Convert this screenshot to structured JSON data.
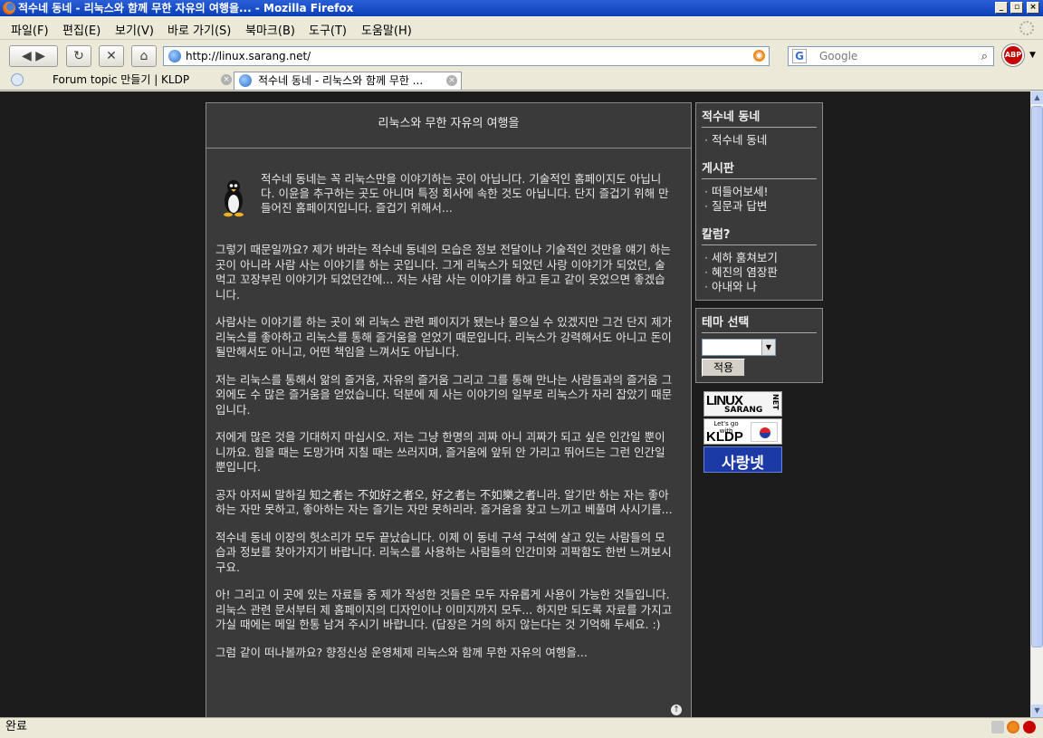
{
  "window": {
    "title": "적수네 동네 - 리눅스와 함께 무한 자유의 여행을... - Mozilla Firefox",
    "min": "_",
    "max": "▫",
    "close": "×"
  },
  "menu": [
    "파일(F)",
    "편집(E)",
    "보기(V)",
    "바로 가기(S)",
    "북마크(B)",
    "도구(T)",
    "도움말(H)"
  ],
  "nav": {
    "back": "◀ ▶",
    "reload": "↻",
    "stop": "✕",
    "home": "⌂",
    "url": "http://linux.sarang.net/",
    "search_placeholder": "Google",
    "search_engine": "G",
    "abp": "ABP"
  },
  "tabs": [
    {
      "label": "Forum topic 만들기 | KLDP",
      "active": false
    },
    {
      "label": "적수네 동네 - 리눅스와 함께 무한 ...",
      "active": true
    }
  ],
  "page": {
    "header": "리눅스와 무한 자유의 여행을",
    "intro": "적수네 동네는 꼭 리눅스만을 이야기하는 곳이 아닙니다. 기술적인 홈페이지도 아닙니다. 이윤을 추구하는 곳도 아니며 특정 회사에 속한 것도 아닙니다. 단지 즐겁기 위해 만들어진 홈페이지입니다. 즐겁기 위해서...",
    "paragraphs": [
      "그렇기 때문일까요? 제가 바라는 적수네 동네의 모습은 정보 전달이나 기술적인 것만을 얘기 하는 곳이 아니라 사람 사는 이야기를 하는 곳입니다. 그게 리눅스가 되었던 사랑 이야기가 되었던, 술 먹고 꼬장부린 이야기가 되었던간에... 저는 사람 사는 이야기를 하고 듣고 같이 웃었으면 좋겠습니다.",
      "사람사는 이야기를 하는 곳이 왜 리눅스 관련 페이지가 됐는냐 물으실 수 있겠지만 그건 단지 제가 리눅스를 좋아하고 리눅스를 통해 즐거움을 얻었기 때문입니다. 리눅스가 강력해서도 아니고 돈이 될만해서도 아니고, 어떤 책임을 느껴서도 아닙니다.",
      "저는 리눅스를 통해서 앎의 즐거움, 자유의 즐거움 그리고 그를 통해 만나는 사람들과의 즐거움 그 외에도 수 많은 즐거움을 얻었습니다. 덕분에 제 사는 이야기의 일부로 리눅스가 자리 잡았기 때문입니다.",
      "저에게 많은 것을 기대하지 마십시오. 저는 그냥 한명의 괴짜 아니 괴짜가 되고 싶은 인간일 뿐이니까요. 힘을 때는 도망가며 지칠 때는 쓰러지며, 즐거움에 앞뒤 안 가리고 뛰어드는 그런 인간일 뿐입니다.",
      "공자 아저씨 말하길 知之者는 不如好之者오, 好之者는 不如樂之者니라. 알기만 하는 자는 좋아하는 자만 못하고, 좋아하는 자는 즐기는 자만 못하리라. 즐거움을 찾고 느끼고 베풀며 사시기를...",
      "적수네 동네 이장의 헛소리가 모두 끝났습니다. 이제 이 동네 구석 구석에 살고 있는 사람들의 모습과 정보를 찾아가지기 바랍니다. 리눅스를 사용하는 사람들의 인간미와 괴팍함도 한번 느껴보시구요.",
      "아! 그리고 이 곳에 있는 자료들 중 제가 작성한 것들은 모두 자유롭게 사용이 가능한 것들입니다. 리눅스 관련 문서부터 제 홈페이지의 디자인이나 이미지까지 모두... 하지만 되도록 자료를 가지고 가실 때에는 메일 한통 남겨 주시기 바랍니다. (답장은 거의 하지 않는다는 것 기억해 두세요. :)",
      "그럼 같이 떠나볼까요? 향정신성 운영체제 리눅스와 함께 무한 자유의 여행을..."
    ],
    "top_icon": "↑"
  },
  "sidebar": {
    "sections": [
      {
        "title": "적수네 동네",
        "items": [
          "적수네 동네"
        ]
      },
      {
        "title": "게시판",
        "items": [
          "떠들어보세!",
          "질문과 답변"
        ]
      },
      {
        "title": "칼럼?",
        "items": [
          "세하 훔쳐보기",
          "혜진의 염장판",
          "아내와 나"
        ]
      }
    ],
    "theme": {
      "title": "테마 선택",
      "apply": "적용",
      "arrow": "▼"
    }
  },
  "badges": {
    "linux": "LINUX",
    "sarang": "SARANG",
    "net": "NET",
    "kldp_small": "Let's go with",
    "kldp": "KLDP",
    "sarangnet": "사랑넷"
  },
  "status": {
    "text": "완료"
  },
  "colors": {
    "page_bg": "#1c1c1c",
    "panel_bg": "#3a3a3a",
    "panel_border": "#8c8c8c",
    "text": "#e4e4e4",
    "titlebar": "#0a3fb7"
  }
}
